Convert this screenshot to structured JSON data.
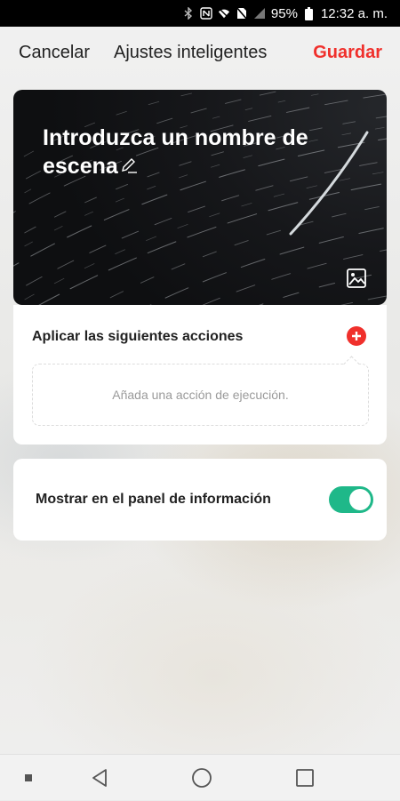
{
  "status_bar": {
    "icons": [
      "bluetooth-icon",
      "nfc-icon",
      "wifi-icon",
      "no-sim-icon",
      "signal-icon",
      "battery-icon"
    ],
    "battery": "95%",
    "time": "12:32 a. m."
  },
  "header": {
    "cancel_label": "Cancelar",
    "title": "Ajustes inteligentes",
    "save_label": "Guardar"
  },
  "scene": {
    "name_placeholder": "Introduzca un nombre de escena",
    "edit_icon": "pencil-icon",
    "image_icon": "image-icon"
  },
  "actions": {
    "title": "Aplicar las siguientes acciones",
    "add_icon": "plus-circle-icon",
    "empty_text": "Añada una acción de ejecución."
  },
  "info_panel": {
    "label": "Mostrar en el panel de información",
    "toggle_on": true
  },
  "nav": {
    "items": [
      "dot-icon",
      "back-icon",
      "home-icon",
      "recents-icon"
    ]
  },
  "colors": {
    "accent_red": "#f0302c",
    "toggle_green": "#1fb889"
  }
}
